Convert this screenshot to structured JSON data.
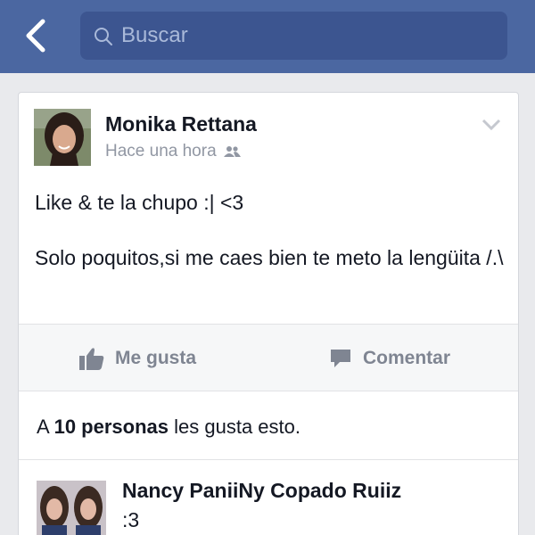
{
  "header": {
    "search_placeholder": "Buscar",
    "bg_color": "#4b67a1"
  },
  "post": {
    "author": "Monika Rettana",
    "time": "Hace una hora",
    "audience_icon": "friends-icon",
    "text_line1": "Like & te la chupo :| <3",
    "text_line2": "Solo poquitos,si me caes bien te meto la lengüita /.\\"
  },
  "actions": {
    "like_label": "Me gusta",
    "comment_label": "Comentar"
  },
  "likes": {
    "prefix": "A",
    "count": "10 personas",
    "suffix": "les gusta esto."
  },
  "comment": {
    "author": "Nancy PaniiNy Copado Ruiiz",
    "text": ":3"
  }
}
